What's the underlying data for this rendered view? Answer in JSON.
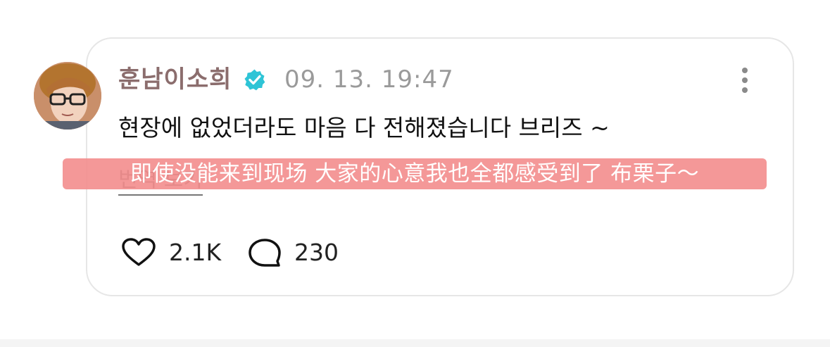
{
  "post": {
    "username": "훈남이소희",
    "timestamp": "09. 13. 19:47",
    "text": "현장에 없었더라도 마음 다 전해졌습니다 브리즈 ~",
    "translation_overlay": "即使没能来到现场 大家的心意我也全都感受到了 布栗子～",
    "see_translation_label": "번역 보기"
  },
  "actions": {
    "likes": "2.1K",
    "comments": "230"
  },
  "icons": {
    "verified": "verified-badge-icon",
    "more": "more-vertical-icon",
    "like": "heart-icon",
    "comment": "comment-bubble-icon"
  },
  "colors": {
    "username": "#8b6d6d",
    "verified": "#2ec4d6",
    "overlay": "#f38f8f",
    "timestamp": "#9a9a9a"
  }
}
